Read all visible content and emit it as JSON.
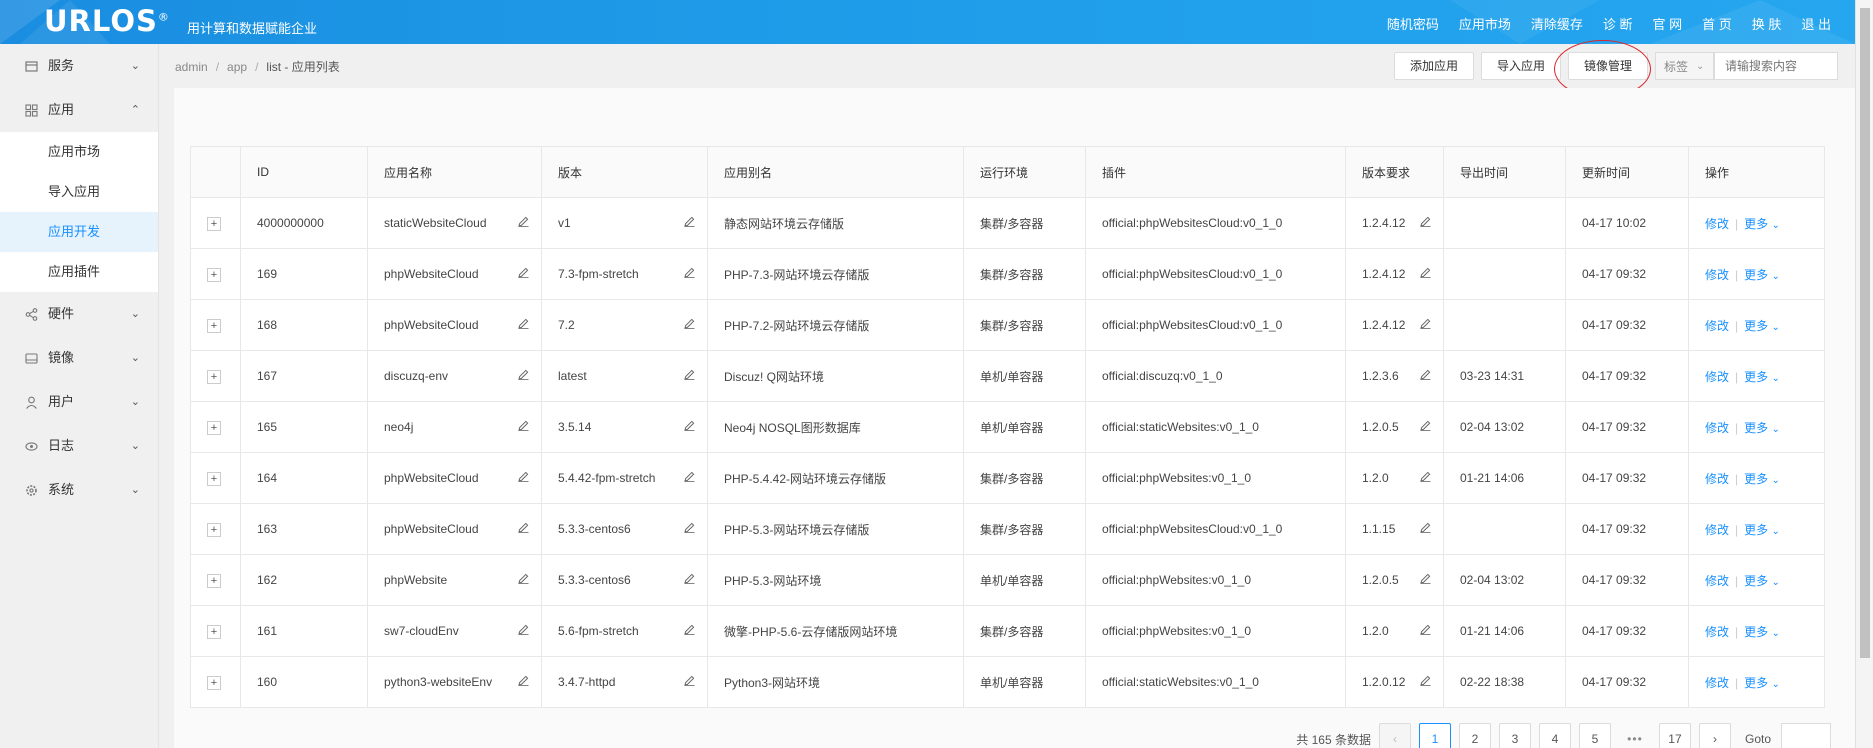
{
  "header": {
    "logo": "URLOS",
    "logo_mark": "®",
    "slogan": "用计算和数据赋能企业",
    "nav": [
      "随机密码",
      "应用市场",
      "清除缓存",
      "诊 断",
      "官 网",
      "首 页",
      "换 肤",
      "退 出"
    ]
  },
  "sidebar": {
    "items": [
      {
        "label": "服务",
        "icon": "store-icon",
        "expanded": false
      },
      {
        "label": "应用",
        "icon": "grid-icon",
        "expanded": true
      },
      {
        "label": "硬件",
        "icon": "share-icon",
        "expanded": false
      },
      {
        "label": "镜像",
        "icon": "disk-icon",
        "expanded": false
      },
      {
        "label": "用户",
        "icon": "user-icon",
        "expanded": false
      },
      {
        "label": "日志",
        "icon": "eye-icon",
        "expanded": false
      },
      {
        "label": "系统",
        "icon": "gear-icon",
        "expanded": false
      }
    ],
    "app_sub": [
      "应用市场",
      "导入应用",
      "应用开发",
      "应用插件"
    ],
    "active_sub": "应用开发"
  },
  "breadcrumb": {
    "parts": [
      "admin",
      "app",
      "list"
    ],
    "current": "- 应用列表"
  },
  "toolbar": {
    "add": "添加应用",
    "import": "导入应用",
    "mirror": "镜像管理",
    "tag": "标签",
    "search_placeholder": "请输搜索内容"
  },
  "table": {
    "headers": [
      "ID",
      "应用名称",
      "版本",
      "应用别名",
      "运行环境",
      "插件",
      "版本要求",
      "导出时间",
      "更新时间",
      "操作"
    ],
    "rows": [
      {
        "id": "4000000000",
        "name": "staticWebsiteCloud",
        "version": "v1",
        "alias": "静态网站环境云存储版",
        "env": "集群/多容器",
        "plugin": "official:phpWebsitesCloud:v0_1_0",
        "req": "1.2.4.12",
        "export": "",
        "update": "04-17 10:02"
      },
      {
        "id": "169",
        "name": "phpWebsiteCloud",
        "version": "7.3-fpm-stretch",
        "alias": "PHP-7.3-网站环境云存储版",
        "env": "集群/多容器",
        "plugin": "official:phpWebsitesCloud:v0_1_0",
        "req": "1.2.4.12",
        "export": "",
        "update": "04-17 09:32"
      },
      {
        "id": "168",
        "name": "phpWebsiteCloud",
        "version": "7.2",
        "alias": "PHP-7.2-网站环境云存储版",
        "env": "集群/多容器",
        "plugin": "official:phpWebsitesCloud:v0_1_0",
        "req": "1.2.4.12",
        "export": "",
        "update": "04-17 09:32"
      },
      {
        "id": "167",
        "name": "discuzq-env",
        "version": "latest",
        "alias": "Discuz! Q网站环境",
        "env": "单机/单容器",
        "plugin": "official:discuzq:v0_1_0",
        "req": "1.2.3.6",
        "export": "03-23 14:31",
        "update": "04-17 09:32"
      },
      {
        "id": "165",
        "name": "neo4j",
        "version": "3.5.14",
        "alias": "Neo4j NOSQL图形数据库",
        "env": "单机/单容器",
        "plugin": "official:staticWebsites:v0_1_0",
        "req": "1.2.0.5",
        "export": "02-04 13:02",
        "update": "04-17 09:32"
      },
      {
        "id": "164",
        "name": "phpWebsiteCloud",
        "version": "5.4.42-fpm-stretch",
        "alias": "PHP-5.4.42-网站环境云存储版",
        "env": "集群/多容器",
        "plugin": "official:phpWebsites:v0_1_0",
        "req": "1.2.0",
        "export": "01-21 14:06",
        "update": "04-17 09:32"
      },
      {
        "id": "163",
        "name": "phpWebsiteCloud",
        "version": "5.3.3-centos6",
        "alias": "PHP-5.3-网站环境云存储版",
        "env": "集群/多容器",
        "plugin": "official:phpWebsitesCloud:v0_1_0",
        "req": "1.1.15",
        "export": "",
        "update": "04-17 09:32"
      },
      {
        "id": "162",
        "name": "phpWebsite",
        "version": "5.3.3-centos6",
        "alias": "PHP-5.3-网站环境",
        "env": "单机/单容器",
        "plugin": "official:phpWebsites:v0_1_0",
        "req": "1.2.0.5",
        "export": "02-04 13:02",
        "update": "04-17 09:32"
      },
      {
        "id": "161",
        "name": "sw7-cloudEnv",
        "version": "5.6-fpm-stretch",
        "alias": "微擎-PHP-5.6-云存储版网站环境",
        "env": "集群/多容器",
        "plugin": "official:phpWebsites:v0_1_0",
        "req": "1.2.0",
        "export": "01-21 14:06",
        "update": "04-17 09:32"
      },
      {
        "id": "160",
        "name": "python3-websiteEnv",
        "version": "3.4.7-httpd",
        "alias": "Python3-网站环境",
        "env": "单机/单容器",
        "plugin": "official:staticWebsites:v0_1_0",
        "req": "1.2.0.12",
        "export": "02-22 18:38",
        "update": "04-17 09:32"
      }
    ],
    "expand_symbol": "+",
    "action_edit": "修改",
    "action_more": "更多"
  },
  "pagination": {
    "total": "共 165 条数据",
    "pages": [
      "1",
      "2",
      "3",
      "4",
      "5"
    ],
    "ellipsis": "•••",
    "last": "17",
    "current": "1",
    "goto": "Goto"
  },
  "colors": {
    "accent": "#1890ff",
    "header": "#1e9be8",
    "highlight_circle": "#d9252c"
  }
}
